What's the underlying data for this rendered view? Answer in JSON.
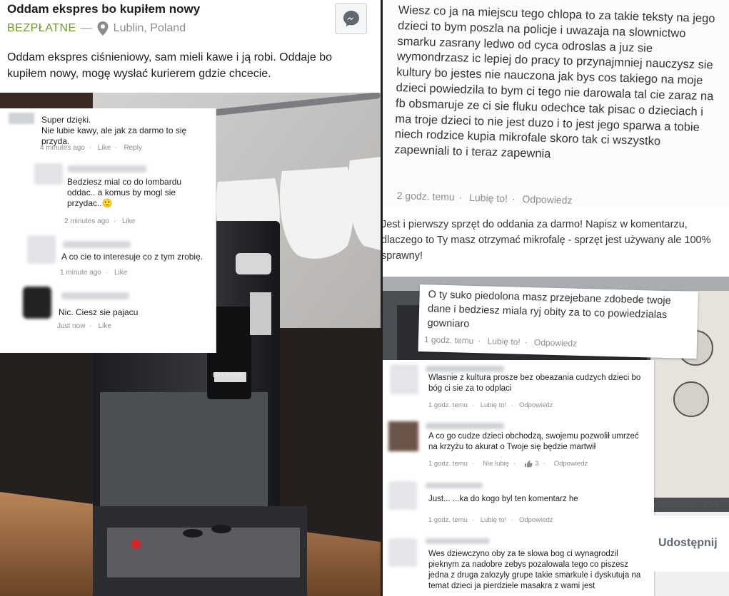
{
  "listing": {
    "title": "Oddam ekspres bo kupiłem nowy",
    "price": "BEZPŁATNE",
    "separator": "—",
    "location": "Lublin, Poland",
    "description": "Oddam ekspres ciśnieniowy, sam mieli kawe i ją robi. Oddaje bo kupiłem nowy, mogę wysłać kurierem gdzie chcecie.",
    "machine_brand": "NIVONA"
  },
  "left_comments": [
    {
      "text": "Super dzięki.\nNie lubie kawy, ale jak za darmo to się przyda.",
      "time": "4 minutes ago",
      "like": "Like",
      "reply": "Reply"
    },
    {
      "text": "Bedziesz mial co do lombardu\noddac.. a komus by mogl sie\nprzydac..🙂",
      "time": "2 minutes ago",
      "like": "Like"
    },
    {
      "text": "A co cie to interesuje co z tym zrobię.",
      "time": "1 minute ago",
      "like": "Like"
    },
    {
      "text": "Nic. Ciesz sie pajacu",
      "time": "Just now",
      "like": "Like"
    }
  ],
  "right_top": {
    "text": "Wiesz co ja na miejscu tego chlopa to za takie teksty na jego dzieci to bym poszla na policje i uwazaja na slownictwo smarku zasrany ledwo od cyca odroslas a juz sie wymondrzasz ic lepiej do pracy to przynajmniej nauczysz sie kultury bo jestes nie nauczona jak bys cos takiego na moje dzieci powiedzila to bym ci tego nie darowala tal cie zaraz na fb obsmaruje ze ci sie fluku odechce tak pisac o dzieciach i ma troje dzieci to nie jest duzo i to jest jego sparwa a tobie niech rodzice kupia mikrofale skoro tak ci wszystko zapewniali to i teraz zapewnia",
    "time": "2 godz. temu",
    "like": "Lubię to!",
    "reply": "Odpowiedz"
  },
  "post": {
    "text": "Jest i pierwszy sprzęt do oddania za darmo! Napisz w komentarzu, dlaczego to Ty masz otrzymać mikrofalę - sprzęt jest używany ale 100% sprawny!"
  },
  "right_mid": {
    "text": "O ty suko piedolona masz przejebane zdobede twoje dane i bedziesz miala ryj obity za to co powiedzialas gowniaro",
    "time": "1 godz. temu",
    "like": "Lubię to!",
    "reply": "Odpowiedz"
  },
  "right_list": [
    {
      "text": "Wlasnie z kultura prosze bez obeazania cudzych dzieci bo bóg ci sie za to odplaci",
      "time": "1 godz. temu",
      "like": "Lubię to!",
      "reply": "Odpowiedz"
    },
    {
      "text": "A co go cudze dzieci obchodzą, swojemu pozwolił umrzeć na krzyżu to akurat o Twoje się będzie martwił",
      "time": "1 godz. temu",
      "like": "Nie lubię",
      "reactions": "3",
      "reply": "Odpowiedz"
    },
    {
      "text": "Just... ...ka do kogo byl ten komentarz he",
      "time": "1 godz. temu",
      "like": "Lubię to!",
      "reply": "Odpowiedz"
    },
    {
      "text": "Wes dziewczyno oby za te slowa bog ci wynagrodzil pieknym za nadobre zebys pozalowala tego co piszesz jedna z druga zalozyly grupe takie smarkule i dyskutuja na temat dzieci ja pierdziele masakra z wami jest"
    }
  ],
  "footer": {
    "comments_label": "omentarze: 110",
    "share_label": "Udostępnij"
  }
}
